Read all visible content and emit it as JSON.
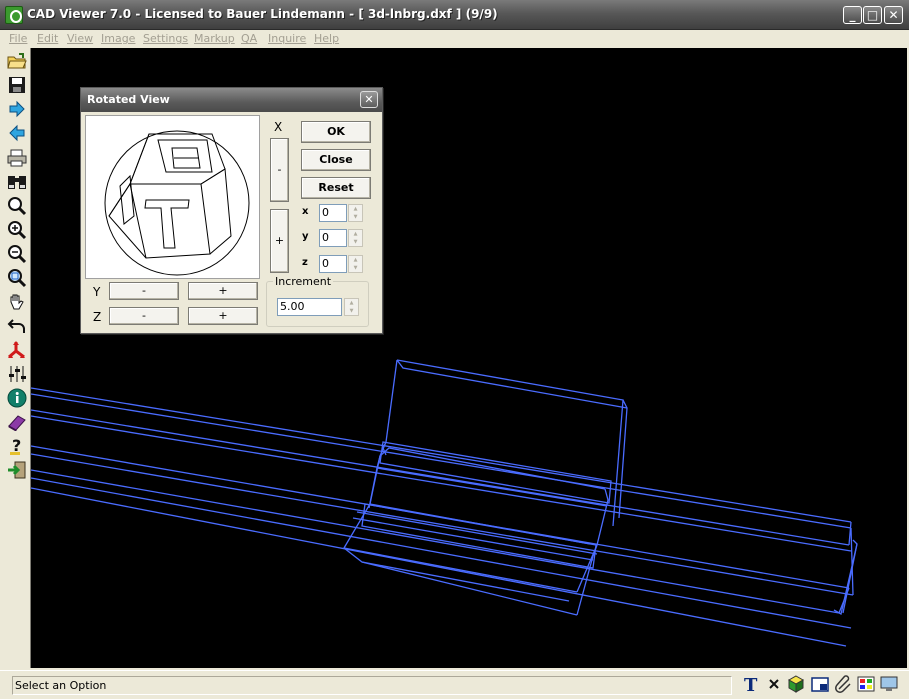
{
  "window": {
    "title": "CAD Viewer 7.0 - Licensed to Bauer Lindemann  - [ 3d-lnbrg.dxf ] (9/9)",
    "minimize_label": "_",
    "maximize_label": "□",
    "close_label": "✕"
  },
  "menu": [
    "File",
    "Edit",
    "View",
    "Image",
    "Settings",
    "Markup",
    "QA",
    "Inquire",
    "Help"
  ],
  "toolbar": {
    "icons": [
      "open-folder-icon",
      "save-disk-icon",
      "next-arrow-icon",
      "previous-arrow-icon",
      "print-icon",
      "binoculars-icon",
      "magnifier-icon",
      "zoom-in-icon",
      "zoom-out-icon",
      "zoom-window-icon",
      "pan-hand-icon",
      "undo-view-icon",
      "axes-rotate-icon",
      "layers-sliders-icon",
      "info-icon",
      "book-icon",
      "help-question-icon",
      "exit-icon"
    ]
  },
  "dialog": {
    "title": "Rotated View",
    "close_label": "✕",
    "x_label": "X",
    "x_minus": "-",
    "x_plus": "+",
    "y_label": "Y",
    "y_minus": "-",
    "y_plus": "+",
    "z_label": "Z",
    "z_minus": "-",
    "z_plus": "+",
    "ok": "OK",
    "close": "Close",
    "reset": "Reset",
    "angles": [
      {
        "label": "x",
        "value": "0"
      },
      {
        "label": "y",
        "value": "0"
      },
      {
        "label": "z",
        "value": "0"
      }
    ],
    "increment_label": "Increment",
    "increment_value": "5.00"
  },
  "status": {
    "text": "Select an Option",
    "icons": [
      "text-T-icon",
      "close-x-icon",
      "shaded-cube-icon",
      "window-icon",
      "paperclip-icon",
      "color-palette-icon",
      "display-icon"
    ]
  },
  "colors": {
    "canvas_background": "#000000",
    "drawing_lines": "#4a6cff",
    "title_bar": "#585858"
  }
}
